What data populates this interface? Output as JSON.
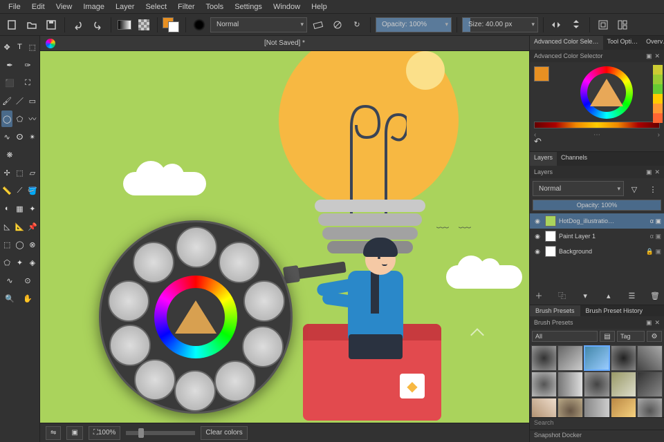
{
  "menu": [
    "File",
    "Edit",
    "View",
    "Image",
    "Layer",
    "Select",
    "Filter",
    "Tools",
    "Settings",
    "Window",
    "Help"
  ],
  "toolbar": {
    "blend_mode": "Normal",
    "opacity": "Opacity: 100%",
    "size": "Size: 40.00 px"
  },
  "doc": {
    "title": "[Not Saved]  *"
  },
  "status": {
    "zoom": "100%",
    "clear": "Clear colors"
  },
  "panels": {
    "tabs_top": [
      "Advanced Color Sele…",
      "Tool Opti…",
      "Overv…"
    ],
    "color_title": "Advanced Color Selector",
    "layers_tabs": [
      "Layers",
      "Channels"
    ],
    "layers": {
      "blend": "Normal",
      "opacity_label": "Opacity:  100%",
      "items": [
        {
          "name": "HotDog_illustratio…",
          "vis": "◉",
          "locked": false,
          "sel": true
        },
        {
          "name": "Paint Layer 1",
          "vis": "◉",
          "locked": false,
          "sel": false
        },
        {
          "name": "Background",
          "vis": "◉",
          "locked": true,
          "sel": false
        }
      ]
    },
    "brush_tabs": [
      "Brush Presets",
      "Brush Preset History"
    ],
    "brush_title": "Brush Presets",
    "brush_filter": "All",
    "brush_tag": "Tag",
    "search": "Search",
    "snapshot": "Snapshot Docker"
  }
}
